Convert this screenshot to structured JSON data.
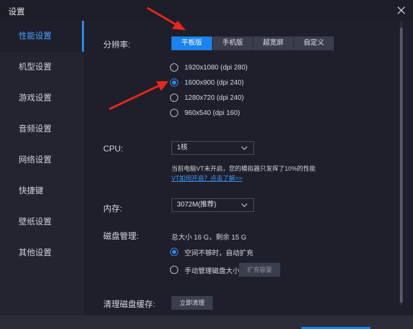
{
  "window": {
    "title": "设置"
  },
  "sidebar": {
    "items": [
      {
        "label": "性能设置"
      },
      {
        "label": "机型设置"
      },
      {
        "label": "游戏设置"
      },
      {
        "label": "音频设置"
      },
      {
        "label": "网络设置"
      },
      {
        "label": "快捷键"
      },
      {
        "label": "壁纸设置"
      },
      {
        "label": "其他设置"
      }
    ]
  },
  "resolution": {
    "label": "分辨率:",
    "tabs": [
      "平板版",
      "手机版",
      "超宽屏",
      "自定义"
    ],
    "active_tab": "平板版",
    "options": [
      "1920x1080 (dpi 280)",
      "1600x900 (dpi 240)",
      "1280x720 (dpi 240)",
      "960x540 (dpi 160)"
    ],
    "selected": "1600x900 (dpi 240)"
  },
  "cpu": {
    "label": "CPU:",
    "value": "1核",
    "hint": "当前电脑VT未开启，您的模拟器只发挥了10%的性能",
    "link": "VT如何开启？点击了解>>"
  },
  "memory": {
    "label": "内存:",
    "value": "3072M(推荐)"
  },
  "disk": {
    "label": "磁盘管理:",
    "info": "总大小 16 G，剩余 15 G",
    "options": [
      "空间不够时，自动扩充",
      "手动管理磁盘大小"
    ],
    "selected": "空间不够时，自动扩充",
    "expand_button": "扩充容量"
  },
  "cache": {
    "label": "清理磁盘缓存:",
    "button": "立即清理"
  },
  "colors": {
    "accent": "#1983ee",
    "annotation": "#e8261c"
  }
}
